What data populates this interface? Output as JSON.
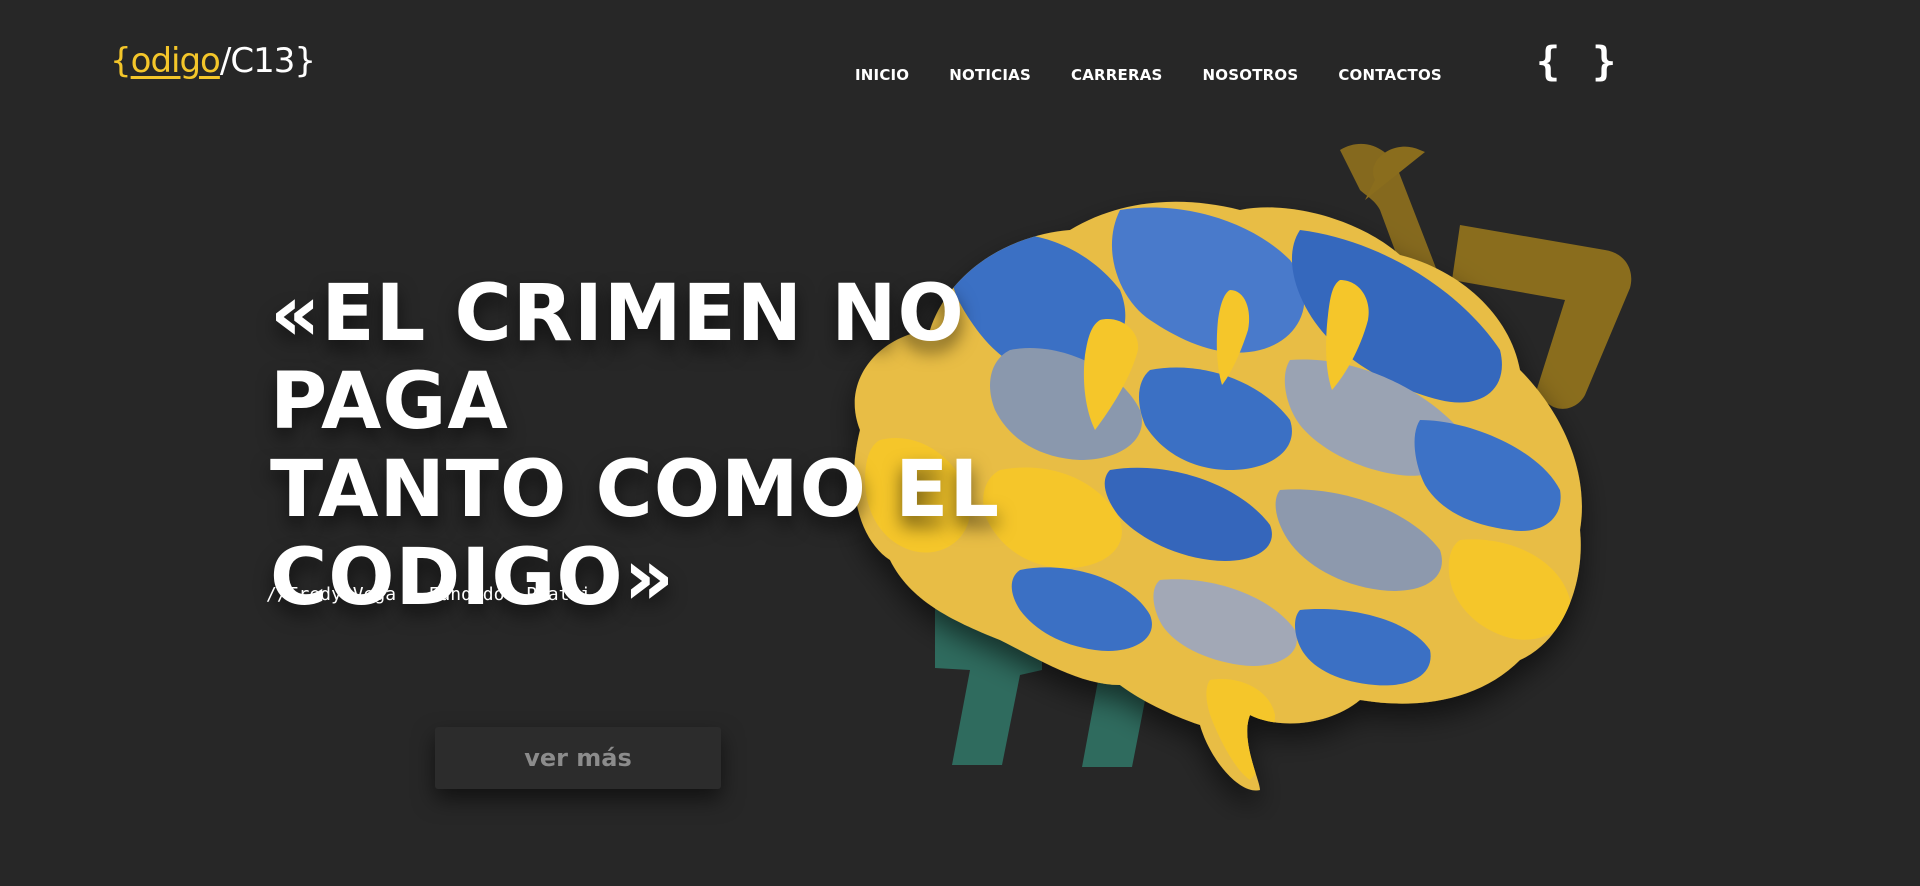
{
  "logo": {
    "open_brace": "{",
    "word": "odigo",
    "slash": "/",
    "code": "C13",
    "close_brace": "}"
  },
  "nav": {
    "items": [
      {
        "label": "INICIO"
      },
      {
        "label": "NOTICIAS"
      },
      {
        "label": "CARRERAS"
      },
      {
        "label": "NOSOTROS"
      },
      {
        "label": "CONTACTOS"
      }
    ]
  },
  "header_icon": {
    "name": "braces-icon",
    "glyph": "{ }"
  },
  "hero": {
    "quote_lines": [
      "«EL CRIMEN NO PAGA",
      "TANTO COMO EL",
      "CODIGO»"
    ],
    "author": "//Fredy Vega – Fundador Platzi",
    "cta_label": "ver más"
  },
  "colors": {
    "background": "#272727",
    "accent_yellow": "#f4c62a",
    "brain_blue": "#3a6fc4",
    "quote_mark_green": "#2f6b5e",
    "chevron_gold": "#8a6d1d",
    "button_text": "#8c8c8c"
  }
}
